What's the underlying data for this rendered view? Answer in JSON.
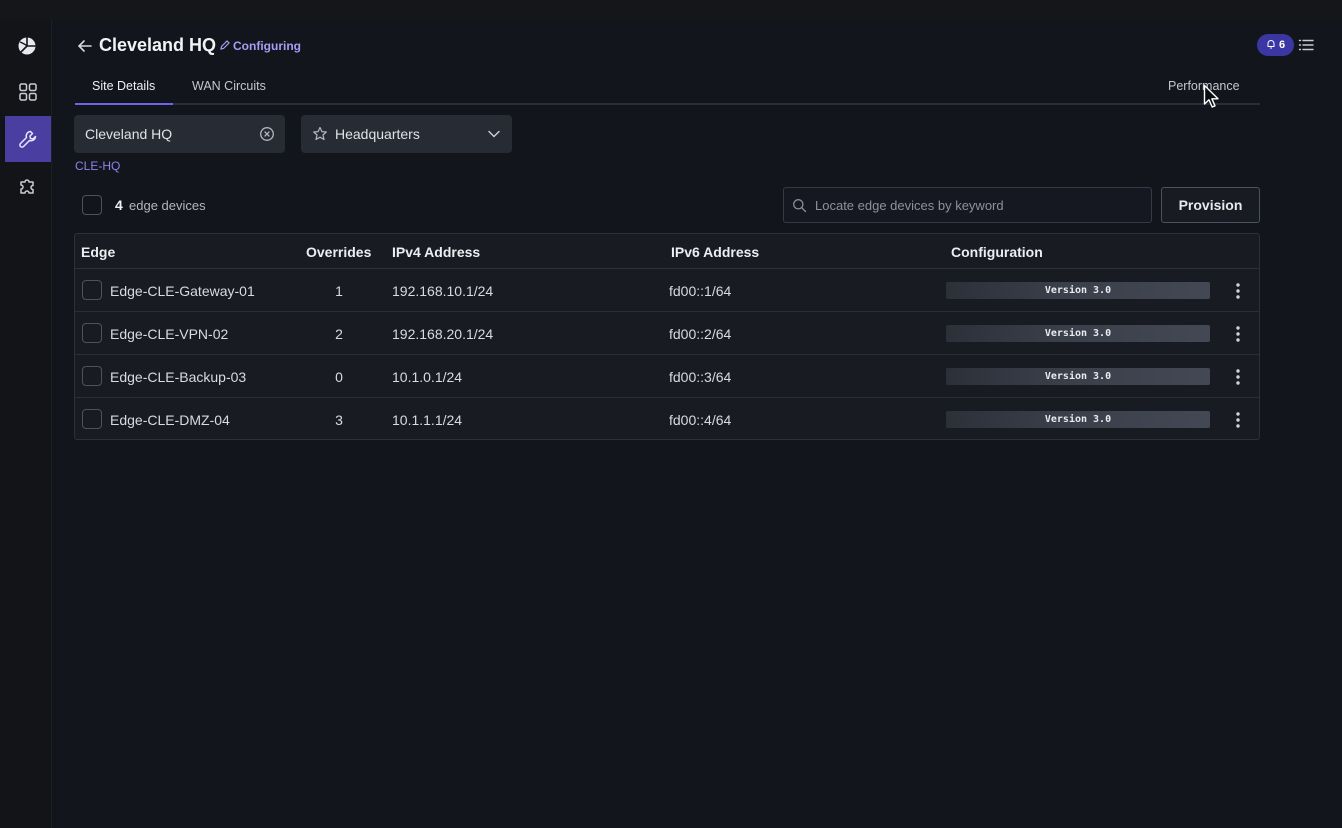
{
  "header": {
    "title": "Cleveland HQ",
    "status": "Configuring",
    "notifications_count": "6"
  },
  "tabs": [
    {
      "label": "Site Details",
      "active": true
    },
    {
      "label": "WAN Circuits",
      "active": false
    },
    {
      "label": "Performance",
      "active": false
    }
  ],
  "site": {
    "name": "Cleveland HQ",
    "type": "Headquarters",
    "code": "CLE-HQ"
  },
  "devices": {
    "count": "4",
    "count_label": "edge devices",
    "search_placeholder": "Locate edge devices by keyword",
    "provision_label": "Provision"
  },
  "table": {
    "columns": [
      "Edge",
      "Overrides",
      "IPv4 Address",
      "IPv6 Address",
      "Configuration"
    ],
    "rows": [
      {
        "edge": "Edge-CLE-Gateway-01",
        "overrides": "1",
        "ipv4": "192.168.10.1/24",
        "ipv6": "fd00::1/64",
        "config": "Version 3.0"
      },
      {
        "edge": "Edge-CLE-VPN-02",
        "overrides": "2",
        "ipv4": "192.168.20.1/24",
        "ipv6": "fd00::2/64",
        "config": "Version 3.0"
      },
      {
        "edge": "Edge-CLE-Backup-03",
        "overrides": "0",
        "ipv4": "10.1.0.1/24",
        "ipv6": "fd00::3/64",
        "config": "Version 3.0"
      },
      {
        "edge": "Edge-CLE-DMZ-04",
        "overrides": "3",
        "ipv4": "10.1.1.1/24",
        "ipv6": "fd00::4/64",
        "config": "Version 3.0"
      }
    ]
  },
  "colors": {
    "accent": "#6e62e8",
    "active_nav": "#4a3fa0",
    "badge": "#3c36a3",
    "link": "#8d83ea"
  },
  "icons": [
    "logo-icon",
    "dashboard-icon",
    "wrench-icon",
    "extension-icon",
    "back-arrow-icon",
    "pencil-icon",
    "bell-icon",
    "list-icon",
    "clear-icon",
    "star-icon",
    "chevron-down-icon",
    "search-icon",
    "kebab-icon"
  ]
}
